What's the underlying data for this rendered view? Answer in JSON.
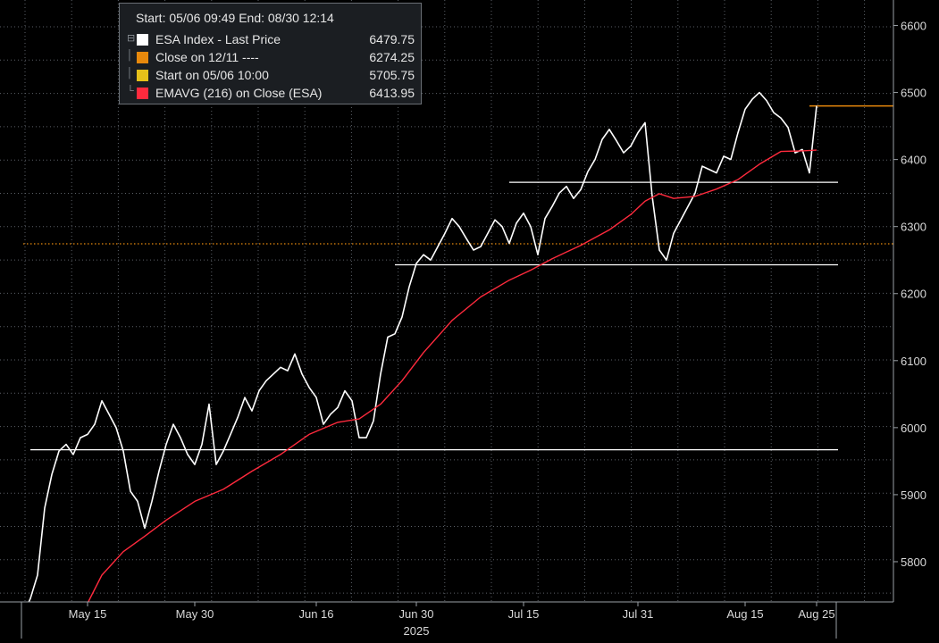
{
  "chart_data": {
    "type": "line",
    "legend": {
      "header": "Start: 05/06 09:49 End: 08/30 12:14",
      "entries": [
        {
          "label": "ESA Index - Last Price",
          "value": "6479.75",
          "color": "#ffffff"
        },
        {
          "label": "Close on 12/11 ----",
          "value": "6274.25",
          "color": "#e8890c"
        },
        {
          "label": "Start on 05/06 10:00",
          "value": "5705.75",
          "color": "#e5c01a"
        },
        {
          "label": "EMAVG (216)  on Close (ESA)",
          "value": "6413.95",
          "color": "#ff2a3d"
        }
      ],
      "placement": "top-left"
    },
    "y_ticks": [
      5800,
      5900,
      6000,
      6100,
      6200,
      6300,
      6400,
      6500,
      6600
    ],
    "ylim": [
      5740,
      6638
    ],
    "y_axis_side": "right",
    "x_ticks": [
      {
        "label": "May 15",
        "day": 9
      },
      {
        "label": "May 30",
        "day": 24
      },
      {
        "label": "Jun 16",
        "day": 41
      },
      {
        "label": "Jun 30",
        "day": 55
      },
      {
        "label": "Jul 15",
        "day": 70
      },
      {
        "label": "Jul 31",
        "day": 86
      },
      {
        "label": "Aug 15",
        "day": 101
      },
      {
        "label": "Aug 25",
        "day": 111
      }
    ],
    "x_year_label": "2025",
    "xlim_days": [
      0,
      117
    ],
    "grid": true,
    "reference_lines": [
      {
        "name": "support-1",
        "value": 5967,
        "from_day": 1,
        "to_day": 114
      },
      {
        "name": "support-2",
        "value": 6243,
        "from_day": 52,
        "to_day": 114
      },
      {
        "name": "support-3",
        "value": 6366,
        "from_day": 68,
        "to_day": 114
      },
      {
        "name": "close-12-11",
        "value": 6274.25,
        "from_day": 0,
        "to_day": 117,
        "dotted": true
      }
    ],
    "last_price_marker": {
      "value": 6480,
      "from_day": 110,
      "to_day": 117
    },
    "series": [
      {
        "name": "ESA Index - Last Price",
        "color": "#ffffff",
        "points": [
          [
            0,
            5722
          ],
          [
            1,
            5745
          ],
          [
            2,
            5780
          ],
          [
            3,
            5880
          ],
          [
            4,
            5930
          ],
          [
            5,
            5965
          ],
          [
            6,
            5975
          ],
          [
            7,
            5960
          ],
          [
            8,
            5985
          ],
          [
            9,
            5990
          ],
          [
            10,
            6005
          ],
          [
            11,
            6040
          ],
          [
            12,
            6020
          ],
          [
            13,
            6000
          ],
          [
            14,
            5965
          ],
          [
            15,
            5905
          ],
          [
            16,
            5890
          ],
          [
            17,
            5850
          ],
          [
            18,
            5890
          ],
          [
            19,
            5935
          ],
          [
            20,
            5975
          ],
          [
            21,
            6005
          ],
          [
            22,
            5985
          ],
          [
            23,
            5960
          ],
          [
            24,
            5945
          ],
          [
            25,
            5975
          ],
          [
            26,
            6035
          ],
          [
            27,
            5945
          ],
          [
            28,
            5965
          ],
          [
            29,
            5990
          ],
          [
            30,
            6015
          ],
          [
            31,
            6045
          ],
          [
            32,
            6025
          ],
          [
            33,
            6055
          ],
          [
            34,
            6070
          ],
          [
            35,
            6080
          ],
          [
            36,
            6090
          ],
          [
            37,
            6085
          ],
          [
            38,
            6110
          ],
          [
            39,
            6080
          ],
          [
            40,
            6060
          ],
          [
            41,
            6045
          ],
          [
            42,
            6005
          ],
          [
            43,
            6020
          ],
          [
            44,
            6030
          ],
          [
            45,
            6055
          ],
          [
            46,
            6040
          ],
          [
            47,
            5985
          ],
          [
            48,
            5985
          ],
          [
            49,
            6010
          ],
          [
            50,
            6080
          ],
          [
            51,
            6135
          ],
          [
            52,
            6140
          ],
          [
            53,
            6165
          ],
          [
            54,
            6210
          ],
          [
            55,
            6245
          ],
          [
            56,
            6258
          ],
          [
            57,
            6250
          ],
          [
            58,
            6270
          ],
          [
            59,
            6290
          ],
          [
            60,
            6312
          ],
          [
            61,
            6300
          ],
          [
            62,
            6282
          ],
          [
            63,
            6265
          ],
          [
            64,
            6270
          ],
          [
            65,
            6290
          ],
          [
            66,
            6310
          ],
          [
            67,
            6300
          ],
          [
            68,
            6275
          ],
          [
            69,
            6305
          ],
          [
            70,
            6320
          ],
          [
            71,
            6300
          ],
          [
            72,
            6258
          ],
          [
            73,
            6312
          ],
          [
            74,
            6330
          ],
          [
            75,
            6350
          ],
          [
            76,
            6360
          ],
          [
            77,
            6342
          ],
          [
            78,
            6355
          ],
          [
            79,
            6382
          ],
          [
            80,
            6400
          ],
          [
            81,
            6430
          ],
          [
            82,
            6445
          ],
          [
            83,
            6428
          ],
          [
            84,
            6410
          ],
          [
            85,
            6420
          ],
          [
            86,
            6440
          ],
          [
            87,
            6455
          ],
          [
            88,
            6345
          ],
          [
            89,
            6265
          ],
          [
            90,
            6250
          ],
          [
            91,
            6290
          ],
          [
            92,
            6310
          ],
          [
            93,
            6330
          ],
          [
            94,
            6350
          ],
          [
            95,
            6390
          ],
          [
            96,
            6385
          ],
          [
            97,
            6380
          ],
          [
            98,
            6405
          ],
          [
            99,
            6400
          ],
          [
            100,
            6440
          ],
          [
            101,
            6475
          ],
          [
            102,
            6490
          ],
          [
            103,
            6500
          ],
          [
            104,
            6488
          ],
          [
            105,
            6470
          ],
          [
            106,
            6462
          ],
          [
            107,
            6448
          ],
          [
            108,
            6410
          ],
          [
            109,
            6415
          ],
          [
            110,
            6380
          ],
          [
            111,
            6480
          ]
        ]
      },
      {
        "name": "EMAVG (216)  on Close (ESA)",
        "color": "#ff2a3d",
        "points": [
          [
            9,
            5738
          ],
          [
            11,
            5780
          ],
          [
            14,
            5815
          ],
          [
            17,
            5838
          ],
          [
            20,
            5862
          ],
          [
            24,
            5890
          ],
          [
            28,
            5908
          ],
          [
            32,
            5935
          ],
          [
            36,
            5960
          ],
          [
            40,
            5990
          ],
          [
            44,
            6008
          ],
          [
            47,
            6013
          ],
          [
            50,
            6035
          ],
          [
            53,
            6070
          ],
          [
            56,
            6112
          ],
          [
            60,
            6160
          ],
          [
            64,
            6195
          ],
          [
            68,
            6220
          ],
          [
            71,
            6235
          ],
          [
            74,
            6252
          ],
          [
            78,
            6272
          ],
          [
            82,
            6295
          ],
          [
            85,
            6318
          ],
          [
            87,
            6338
          ],
          [
            89,
            6349
          ],
          [
            91,
            6342
          ],
          [
            94,
            6345
          ],
          [
            97,
            6356
          ],
          [
            100,
            6370
          ],
          [
            103,
            6393
          ],
          [
            106,
            6412
          ],
          [
            109,
            6413
          ],
          [
            111,
            6414
          ]
        ]
      }
    ]
  }
}
